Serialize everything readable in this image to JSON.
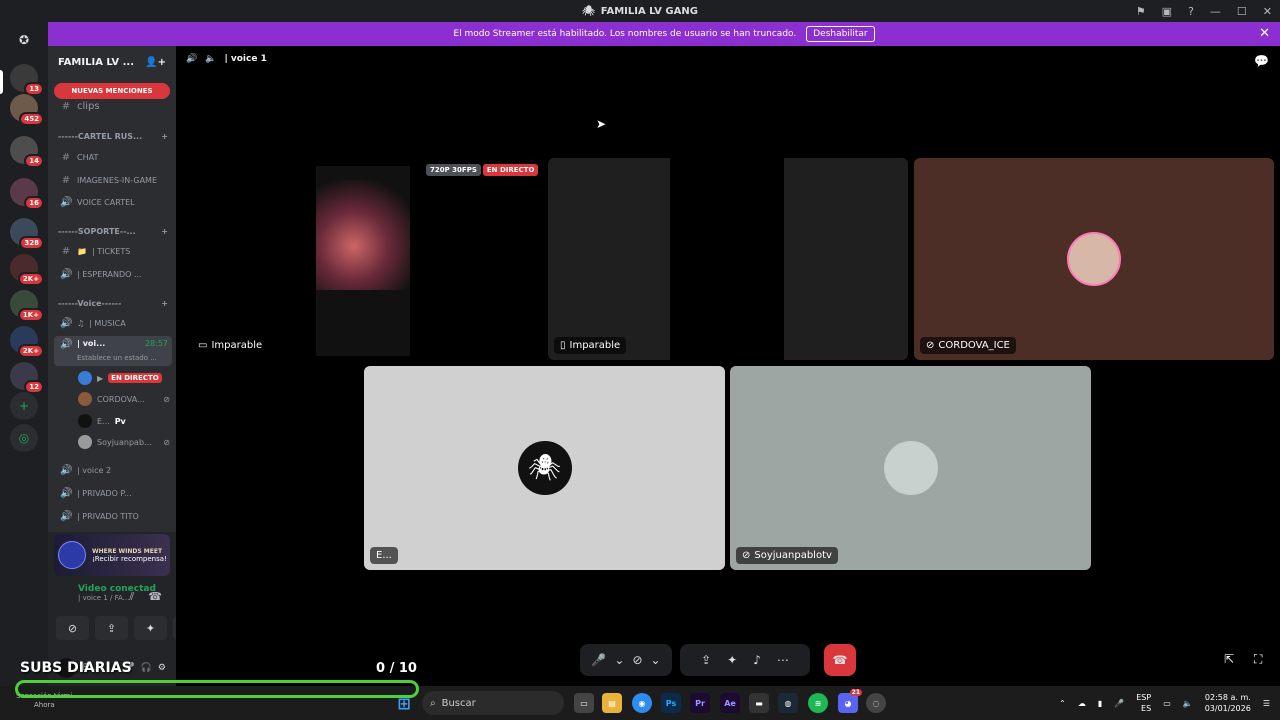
{
  "window": {
    "title": "FAMILIA LV GANG"
  },
  "banner": {
    "text": "El modo Streamer está habilitado. Los nombres de usuario se han truncado.",
    "button": "Deshabilitar"
  },
  "servers": {
    "badges": [
      "13",
      "452",
      "14",
      "16",
      "328",
      "2K+",
      "1K+",
      "2K+",
      "12"
    ]
  },
  "guild": {
    "name": "FAMILIA LV ..."
  },
  "sidebar": {
    "mention": "NUEVAS MENCIONES",
    "clips": "clips",
    "cat_cartel": "------CARTEL RUS...",
    "chat": "CHAT",
    "imagenes": "IMAGENES-IN-GAME",
    "voice_cartel": "VOICE CARTEL",
    "cat_soporte": "------SOPORTE--...",
    "tickets": "| TICKETS",
    "esperando": "| ESPERANDO ...",
    "cat_voice": "------Voice------",
    "musica": "| MUSICA",
    "voice1": "| voi...",
    "voice1_time": "28:57",
    "voice1_status": "Establece un estado ...",
    "members": [
      {
        "name": "",
        "live": "EN DIRECTO"
      },
      {
        "name": "CORDOVA..."
      },
      {
        "name": "E...",
        "tag": "Pv"
      },
      {
        "name": "Soyjuanpab..."
      }
    ],
    "voice2": "| voice 2",
    "privado": "| PRIVADO P...",
    "privado_tito": "| PRIVADO TITO"
  },
  "promo": {
    "title": "WHERE WINDS MEET",
    "cta": "¡Recibir recompensa!"
  },
  "voice_panel": {
    "status": "Video conectad",
    "channel": "| voice 1 / FA..."
  },
  "user": {
    "name": "E..."
  },
  "overlay": {
    "subs_label": "SUBS DIARIAS",
    "count": "0 / 10"
  },
  "stage": {
    "channel": "| voice 1",
    "tiles": [
      {
        "name": "Imparable",
        "quality": "720P 30FPS",
        "live": "EN DIRECTO"
      },
      {
        "name": "Imparable"
      },
      {
        "name": "CORDOVA_ICE"
      },
      {
        "name": "E..."
      },
      {
        "name": "Soyjuanpablotv"
      }
    ]
  },
  "taskbar": {
    "search": "Buscar",
    "notif_title": "Sensación térmi...",
    "notif_time": "Ahora",
    "lang": "ESP",
    "lang2": "ES",
    "time": "02:58 a. m.",
    "date": "03/01/2026",
    "discord_badge": "21"
  },
  "colors": {
    "accent": "#8c2fd1",
    "live": "#da373c",
    "online": "#23a559",
    "progress": "#4cd137"
  }
}
